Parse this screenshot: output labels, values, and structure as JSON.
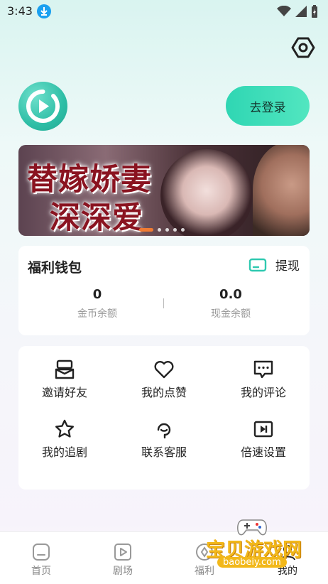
{
  "status": {
    "time": "3:43"
  },
  "header": {
    "login_label": "去登录"
  },
  "banner": {
    "title_line1": "替嫁娇妻",
    "title_line2": "深深爱",
    "dot_count": 5,
    "active_dot": 0
  },
  "wallet": {
    "title": "福利钱包",
    "withdraw_label": "提现",
    "coin_value": "0",
    "coin_label": "金币余额",
    "cash_value": "0.0",
    "cash_label": "现金余额"
  },
  "menu": {
    "items": [
      {
        "label": "邀请好友",
        "icon": "invite-icon"
      },
      {
        "label": "我的点赞",
        "icon": "heart-icon"
      },
      {
        "label": "我的评论",
        "icon": "comment-icon"
      },
      {
        "label": "我的追剧",
        "icon": "star-icon"
      },
      {
        "label": "联系客服",
        "icon": "headset-icon"
      },
      {
        "label": "倍速设置",
        "icon": "speed-icon"
      }
    ]
  },
  "tabbar": {
    "items": [
      {
        "label": "首页",
        "icon": "home-icon"
      },
      {
        "label": "剧场",
        "icon": "theater-icon"
      },
      {
        "label": "福利",
        "icon": "gift-icon"
      },
      {
        "label": "我的",
        "icon": "profile-icon"
      }
    ]
  },
  "watermark": {
    "text": "宝贝游戏网",
    "url": "baobeiy.com"
  },
  "colors": {
    "accent": "#2fd6b3",
    "banner_title": "#8a1320",
    "indicator": "#f07b33"
  }
}
